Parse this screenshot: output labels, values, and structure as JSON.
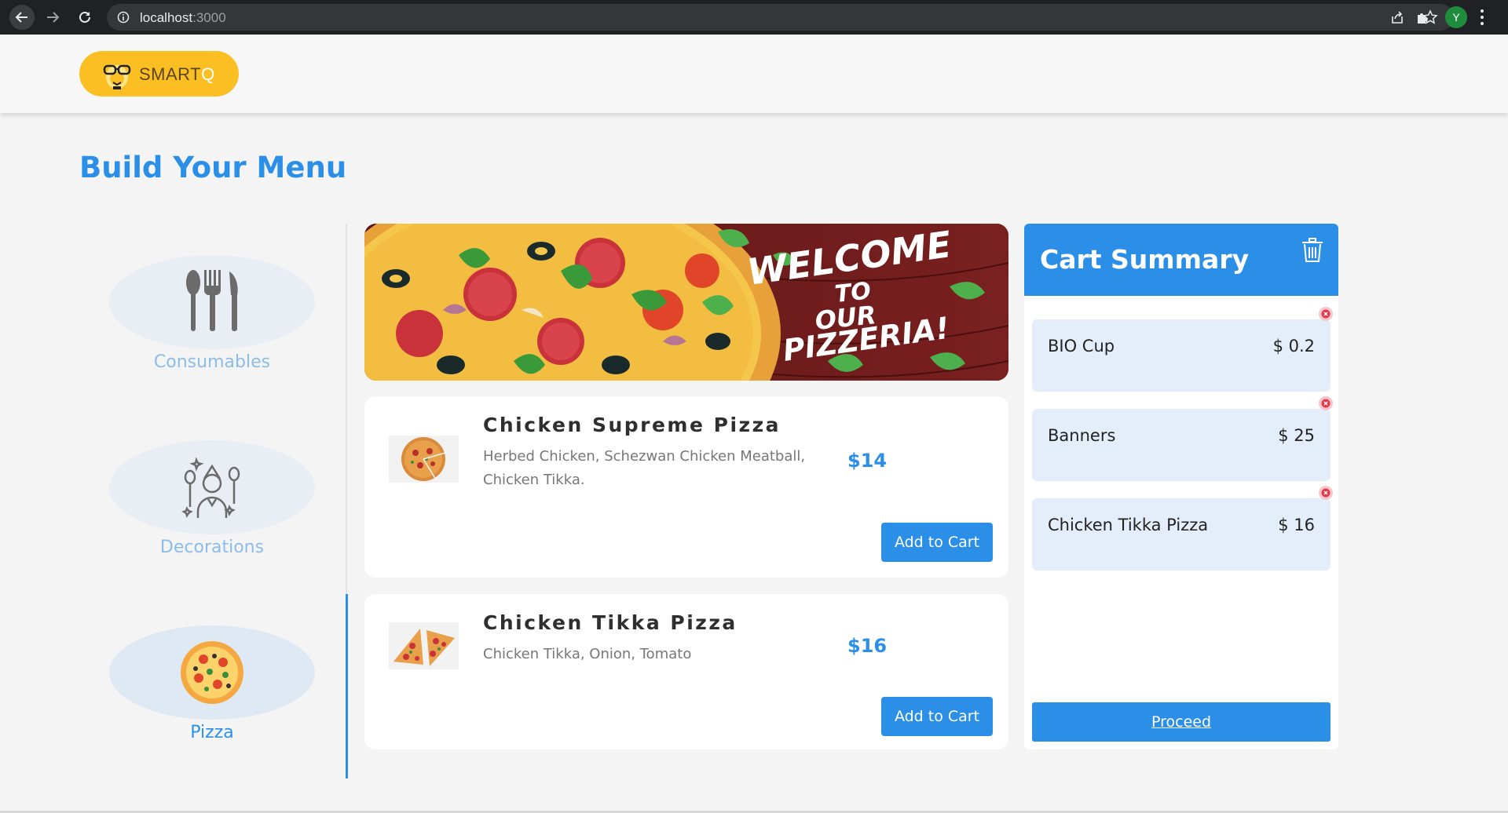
{
  "browser": {
    "url_host": "localhost",
    "url_port": ":3000",
    "profile_initial": "Y"
  },
  "header": {
    "logo_text_main": "SMART",
    "logo_text_accent": "Q"
  },
  "page": {
    "title": "Build Your Menu"
  },
  "categories": [
    {
      "label": "Consumables",
      "icon": "cutlery-icon",
      "active": false
    },
    {
      "label": "Decorations",
      "icon": "party-person-icon",
      "active": false
    },
    {
      "label": "Pizza",
      "icon": "pizza-icon",
      "active": true
    }
  ],
  "banner": {
    "line1": "WELCOME",
    "line2": "TO",
    "line3": "OUR",
    "line4": "PIZZERIA!"
  },
  "products": [
    {
      "name": "Chicken Supreme Pizza",
      "description": "Herbed Chicken, Schezwan Chicken Meatball, Chicken Tikka.",
      "price": "$14",
      "button": "Add to Cart"
    },
    {
      "name": "Chicken Tikka Pizza",
      "description": "Chicken Tikka, Onion, Tomato",
      "price": "$16",
      "button": "Add to Cart"
    }
  ],
  "cart": {
    "title": "Cart Summary",
    "items": [
      {
        "name": "BIO Cup",
        "price": "$ 0.2"
      },
      {
        "name": "Banners",
        "price": "$ 25"
      },
      {
        "name": "Chicken Tikka Pizza",
        "price": "$ 16"
      }
    ],
    "proceed_label": "Proceed"
  },
  "colors": {
    "accent": "#2b8fe8",
    "logo_bg": "#fbbf24",
    "category_inactive_text": "#8cbce9",
    "cart_item_bg": "#e4eefa"
  }
}
